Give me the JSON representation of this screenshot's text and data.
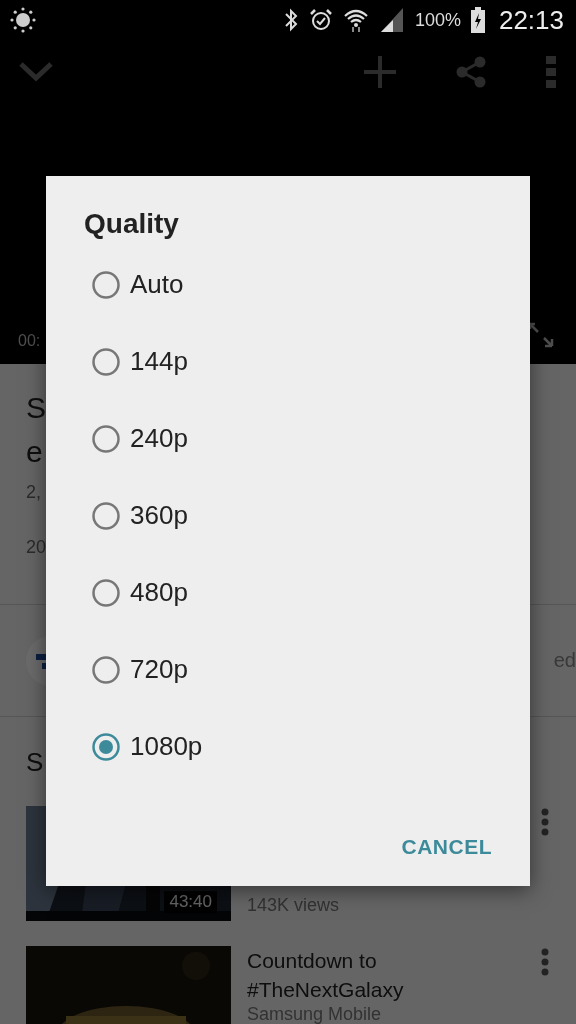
{
  "status_bar": {
    "battery": "100%",
    "time": "22:13"
  },
  "player": {
    "elapsed": "00:"
  },
  "video": {
    "title_lines": [
      "S",
      "e"
    ],
    "views": "2,",
    "date": "20"
  },
  "channel": {
    "subscribe": "ed"
  },
  "suggestions": {
    "heading": "S",
    "items": [
      {
        "duration": "43:40",
        "views": "143K views"
      },
      {
        "title_lines": [
          "Countdown to",
          "#TheNextGalaxy"
        ],
        "channel": "Samsung Mobile"
      }
    ]
  },
  "dialog": {
    "title": "Quality",
    "options": [
      {
        "label": "Auto",
        "selected": false
      },
      {
        "label": "144p",
        "selected": false
      },
      {
        "label": "240p",
        "selected": false
      },
      {
        "label": "360p",
        "selected": false
      },
      {
        "label": "480p",
        "selected": false
      },
      {
        "label": "720p",
        "selected": false
      },
      {
        "label": "1080p",
        "selected": true
      }
    ],
    "cancel": "CANCEL"
  }
}
